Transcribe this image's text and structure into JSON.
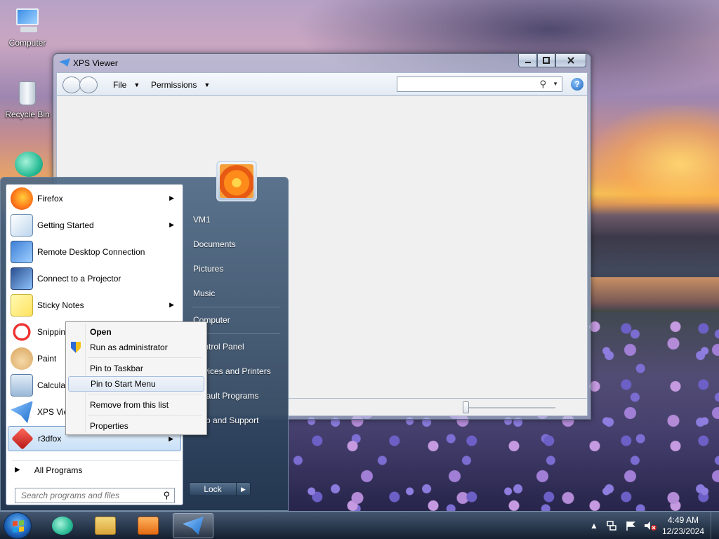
{
  "desktop": {
    "icons": [
      {
        "label": "Computer",
        "icon": "computer-icon"
      },
      {
        "label": "Recycle Bin",
        "icon": "recycle-bin-icon"
      },
      {
        "label": "",
        "icon": "internet-explorer-icon"
      }
    ]
  },
  "xps_window": {
    "title": "XPS Viewer",
    "menus": {
      "file": "File",
      "permissions": "Permissions"
    },
    "search": {
      "value": "",
      "placeholder": ""
    },
    "help": "?"
  },
  "start_menu": {
    "programs": [
      {
        "label": "Firefox",
        "icon": "firefox-icon",
        "submenu": true
      },
      {
        "label": "Getting Started",
        "icon": "getting-started-icon",
        "submenu": true
      },
      {
        "label": "Remote Desktop Connection",
        "icon": "remote-desktop-icon",
        "submenu": false
      },
      {
        "label": "Connect to a Projector",
        "icon": "projector-icon",
        "submenu": false
      },
      {
        "label": "Sticky Notes",
        "icon": "sticky-notes-icon",
        "submenu": true
      },
      {
        "label": "Snipping Tool",
        "icon": "snipping-tool-icon",
        "submenu": false
      },
      {
        "label": "Paint",
        "icon": "paint-icon",
        "submenu": false
      },
      {
        "label": "Calculator",
        "icon": "calculator-icon",
        "submenu": false
      },
      {
        "label": "XPS Viewer",
        "icon": "xps-viewer-icon",
        "submenu": false
      },
      {
        "label": "r3dfox",
        "icon": "r3dfox-icon",
        "submenu": true
      }
    ],
    "all_programs": "All Programs",
    "search_placeholder": "Search programs and files",
    "right_pane": {
      "user": "VM1",
      "items": [
        "Documents",
        "Pictures",
        "Music",
        "Computer",
        "Control Panel",
        "Devices and Printers",
        "Default Programs",
        "Help and Support"
      ]
    },
    "lock": "Lock",
    "lock_arrow": "▶"
  },
  "context_menu": {
    "items": [
      {
        "label": "Open",
        "bold": true
      },
      {
        "label": "Run as administrator",
        "icon": "uac-shield-icon"
      },
      {
        "label": "Pin to Taskbar"
      },
      {
        "label": "Pin to Start Menu",
        "hovered": true
      },
      {
        "label": "Remove from this list"
      },
      {
        "label": "Properties"
      }
    ]
  },
  "taskbar": {
    "apps": [
      {
        "icon": "internet-explorer-icon"
      },
      {
        "icon": "windows-explorer-icon"
      },
      {
        "icon": "media-player-icon"
      },
      {
        "icon": "xps-viewer-icon",
        "active": true
      }
    ],
    "tray": {
      "show_hidden": "▲",
      "network": "network-icon",
      "action_center": "flag-icon",
      "volume": "volume-muted-icon"
    },
    "clock": {
      "time": "4:49 AM",
      "date": "12/23/2024"
    }
  }
}
